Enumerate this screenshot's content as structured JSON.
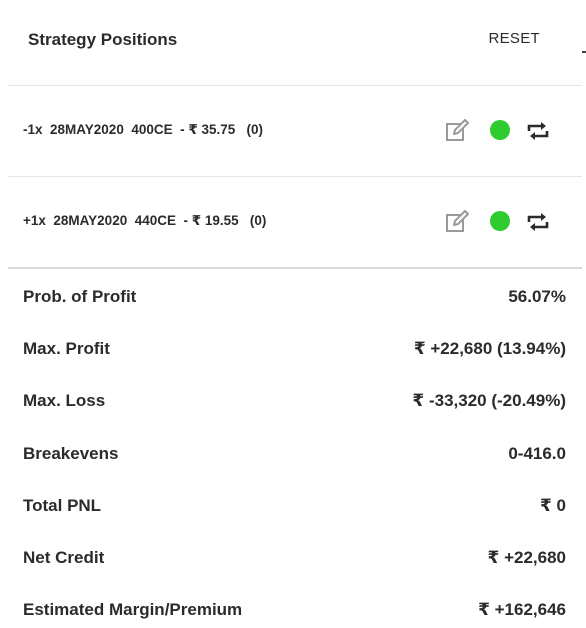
{
  "header": {
    "title": "Strategy Positions",
    "reset_label": "RESET"
  },
  "positions": [
    {
      "text": "-1x  28MAY2020  400CE  - ₹ 35.75   (0)",
      "status_color": "#2ecc2e"
    },
    {
      "text": "+1x  28MAY2020  440CE  - ₹ 19.55   (0)",
      "status_color": "#2ecc2e"
    }
  ],
  "stats": [
    {
      "label": "Prob. of Profit",
      "value": "56.07%"
    },
    {
      "label": "Max. Profit",
      "value": "₹ +22,680 (13.94%)"
    },
    {
      "label": "Max. Loss",
      "value": "₹ -33,320 (-20.49%)"
    },
    {
      "label": "Breakevens",
      "value": "0-416.0"
    },
    {
      "label": "Total PNL",
      "value": "₹ 0"
    },
    {
      "label": "Net Credit",
      "value": "₹ +22,680"
    },
    {
      "label": "Estimated Margin/Premium",
      "value": "₹ +162,646"
    }
  ]
}
